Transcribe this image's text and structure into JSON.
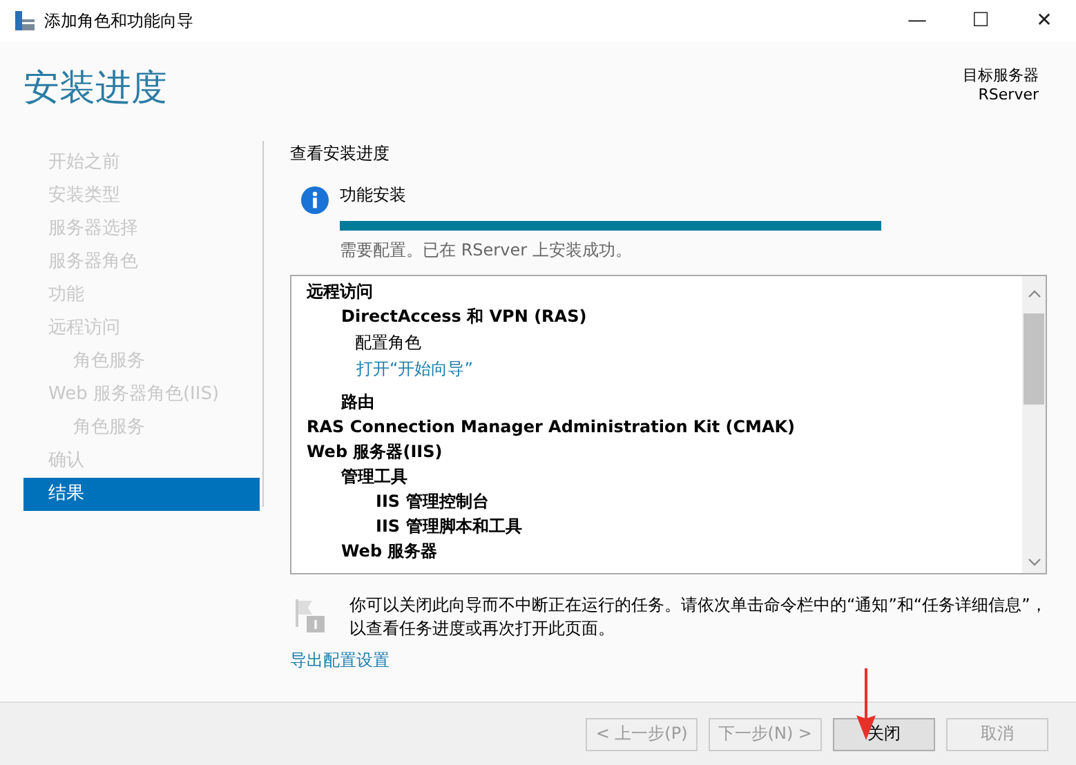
{
  "window": {
    "title": "添加角色和功能向导",
    "controls": [
      "—",
      "☐",
      "✕"
    ]
  },
  "header": {
    "title": "安装进度",
    "target_label": "目标服务器",
    "target_value": "RServer"
  },
  "nav": {
    "items": [
      {
        "label": "开始之前",
        "selected": false
      },
      {
        "label": "安装类型",
        "selected": false
      },
      {
        "label": "服务器选择",
        "selected": false
      },
      {
        "label": "服务器角色",
        "selected": false
      },
      {
        "label": "功能",
        "selected": false
      },
      {
        "label": "远程访问",
        "selected": false,
        "children": [
          {
            "label": "角色服务",
            "selected": false
          }
        ]
      },
      {
        "label": "Web 服务器角色(IIS)",
        "selected": false,
        "children": [
          {
            "label": "角色服务",
            "selected": false
          }
        ]
      },
      {
        "label": "确认",
        "selected": false
      },
      {
        "label": "结果",
        "selected": true
      }
    ]
  },
  "content": {
    "heading": "查看安装进度",
    "status_title": "功能安装",
    "progress": {
      "level": 1.0
    },
    "status_text": "需要配置。已在 RServer 上安装成功。",
    "results": [
      {
        "kind": "bold",
        "label": "远程访问",
        "children": [
          {
            "kind": "bold",
            "label": "DirectAccess 和 VPN (RAS)",
            "children": [
              {
                "kind": "plain",
                "label": "配置角色"
              },
              {
                "kind": "link",
                "label": "打开“开始向导”"
              }
            ]
          },
          {
            "kind": "bold",
            "label": "路由"
          }
        ]
      },
      {
        "kind": "bold",
        "label": "RAS Connection Manager Administration Kit (CMAK)"
      },
      {
        "kind": "bold",
        "label": "Web 服务器(IIS)",
        "children": [
          {
            "kind": "bold",
            "label": "管理工具",
            "children": [
              {
                "kind": "bold",
                "label": "IIS 管理控制台"
              },
              {
                "kind": "bold",
                "label": "IIS 管理脚本和工具"
              }
            ]
          },
          {
            "kind": "bold",
            "label": "Web 服务器"
          }
        ]
      }
    ],
    "note": "你可以关闭此向导而不中断正在运行的任务。请依次单击命令栏中的“通知”和“任务详细信息”，以查看任务进度或再次打开此页面。",
    "export_link": "导出配置设置"
  },
  "buttons": [
    {
      "label": "< 上一步(P)",
      "disabled": true
    },
    {
      "label": "下一步(N) >",
      "disabled": true
    },
    {
      "label": "关闭",
      "disabled": false
    },
    {
      "label": "取消",
      "disabled": true
    }
  ]
}
